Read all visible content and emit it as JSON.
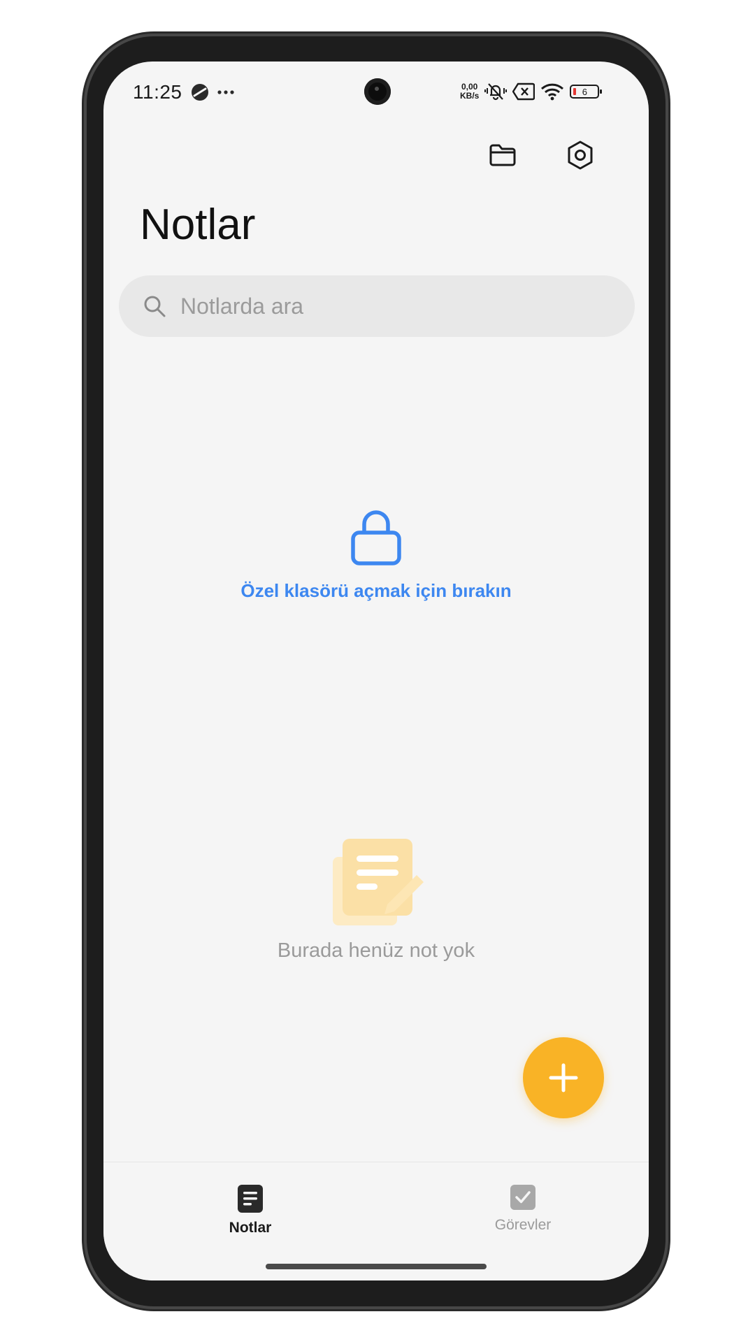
{
  "status_bar": {
    "time": "11:25",
    "net_speed_value": "0,00",
    "net_speed_unit": "KB/s",
    "battery_level": "6",
    "icons": [
      "sync-icon",
      "more-dots-icon",
      "mute-vibrate-icon",
      "no-sim-icon",
      "wifi-icon",
      "battery-icon"
    ]
  },
  "header": {
    "folder_button": "folder-icon",
    "settings_button": "settings-icon",
    "title": "Notlar"
  },
  "search": {
    "placeholder": "Notlarda ara",
    "value": ""
  },
  "private_folder_hint": {
    "icon": "lock-icon",
    "text": "Özel klasörü açmak için bırakın",
    "color": "#3d87f0"
  },
  "empty_state": {
    "icon": "notes-illustration-icon",
    "text": "Burada henüz not yok"
  },
  "fab": {
    "icon": "plus-icon",
    "color": "#f9b326"
  },
  "bottom_nav": {
    "tabs": [
      {
        "label": "Notlar",
        "icon": "note-icon",
        "active": true
      },
      {
        "label": "Görevler",
        "icon": "checkbox-icon",
        "active": false
      }
    ]
  }
}
